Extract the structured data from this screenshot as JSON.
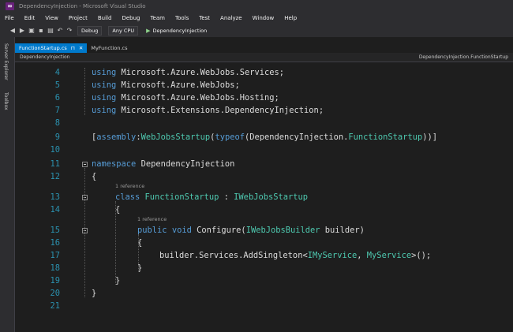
{
  "window": {
    "title": "DependencyInjection - Microsoft Visual Studio"
  },
  "menu": [
    "File",
    "Edit",
    "View",
    "Project",
    "Build",
    "Debug",
    "Team",
    "Tools",
    "Test",
    "Analyze",
    "Window",
    "Help"
  ],
  "toolbar": {
    "config": "Debug",
    "platform": "Any CPU",
    "run_target": "DependencyInjection"
  },
  "side_panels": [
    "Server Explorer",
    "Toolbox"
  ],
  "tabs": [
    {
      "label": "FunctionStartup.cs",
      "active": true
    },
    {
      "label": "MyFunction.cs",
      "active": false
    }
  ],
  "navbar": {
    "project": "DependencyInjection",
    "member": "DependencyInjection.FunctionStartup"
  },
  "editor": {
    "lines": [
      {
        "n": "4",
        "t": "using Microsoft.Azure.WebJobs.Services;"
      },
      {
        "n": "5",
        "t": "using Microsoft.Azure.WebJobs;"
      },
      {
        "n": "6",
        "t": "using Microsoft.Azure.WebJobs.Hosting;"
      },
      {
        "n": "7",
        "t": "using Microsoft.Extensions.DependencyInjection;"
      },
      {
        "n": "8",
        "t": ""
      },
      {
        "n": "9",
        "t": "[assembly:WebJobsStartup(typeof(DependencyInjection.FunctionStartup))]"
      },
      {
        "n": "10",
        "t": ""
      },
      {
        "n": "11",
        "t": "namespace DependencyInjection"
      },
      {
        "n": "12",
        "t": "{"
      },
      {
        "n": "13",
        "t": "class FunctionStartup : IWebJobsStartup"
      },
      {
        "n": "14",
        "t": "{"
      },
      {
        "n": "15",
        "t": "public void Configure(IWebJobsBuilder builder)"
      },
      {
        "n": "16",
        "t": "{"
      },
      {
        "n": "17",
        "t": "builder.Services.AddSingleton<IMyService, MyService>();"
      },
      {
        "n": "18",
        "t": "}"
      },
      {
        "n": "19",
        "t": "}"
      },
      {
        "n": "20",
        "t": "}"
      },
      {
        "n": "21",
        "t": ""
      }
    ],
    "references": [
      {
        "after": "12",
        "text": "1 reference"
      },
      {
        "after": "14",
        "text": "1 reference"
      }
    ]
  },
  "colors": {
    "keyword": "#569cd6",
    "type": "#4ec9b0",
    "accent": "#007acc",
    "line_number": "#2b91af"
  },
  "icons": [
    "vs-logo-icon",
    "back-icon",
    "forward-icon",
    "new-project-icon",
    "save-icon",
    "save-all-icon",
    "undo-icon",
    "redo-icon",
    "start-icon",
    "close-tab-icon",
    "pin-icon"
  ]
}
